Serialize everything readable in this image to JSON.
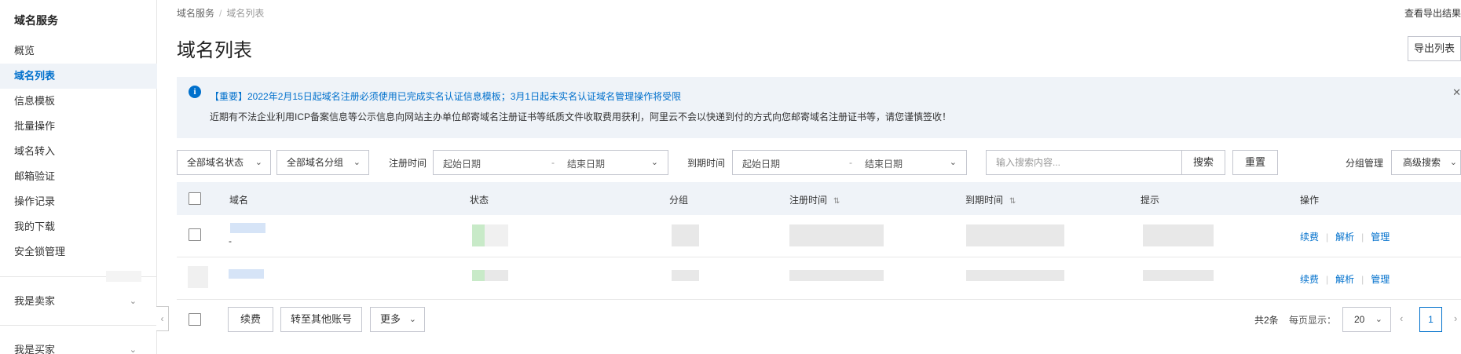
{
  "sidebar": {
    "title": "域名服务",
    "items": [
      {
        "label": "概览"
      },
      {
        "label": "域名列表"
      },
      {
        "label": "信息模板"
      },
      {
        "label": "批量操作"
      },
      {
        "label": "域名转入"
      },
      {
        "label": "邮箱验证"
      },
      {
        "label": "操作记录"
      },
      {
        "label": "我的下载"
      },
      {
        "label": "安全锁管理"
      }
    ],
    "active_index": 1,
    "groups": [
      {
        "label": "我是卖家"
      },
      {
        "label": "我是买家"
      }
    ]
  },
  "breadcrumb": {
    "root": "域名服务",
    "separator": "/",
    "current": "域名列表"
  },
  "page_title": "域名列表",
  "header": {
    "export_results_link": "查看导出结果",
    "export_list_button": "导出列表"
  },
  "notice": {
    "title": "【重要】2022年2月15日起域名注册必须使用已完成实名认证信息模板；3月1日起未实名认证域名管理操作将受限",
    "text": "近期有不法企业利用ICP备案信息等公示信息向网站主办单位邮寄域名注册证书等纸质文件收取费用获利，阿里云不会以快递到付的方式向您邮寄域名注册证书等，请您谨慎签收！",
    "info_icon_glyph": "i",
    "close_glyph": "✕"
  },
  "filters": {
    "status_select": "全部域名状态",
    "group_select": "全部域名分组",
    "reg_time_label": "注册时间",
    "exp_time_label": "到期时间",
    "start_date_placeholder": "起始日期",
    "end_date_placeholder": "结束日期",
    "date_separator": "-",
    "search_placeholder": "输入搜索内容...",
    "search_button": "搜索",
    "reset_button": "重置",
    "group_mgmt": "分组管理",
    "advanced_search": "高级搜索"
  },
  "table": {
    "columns": [
      "域名",
      "状态",
      "分组",
      "注册时间",
      "到期时间",
      "提示",
      "操作"
    ],
    "sort_glyph": "⇅",
    "rows": [
      {
        "domain_suffix": "-",
        "actions": [
          "续费",
          "解析",
          "管理"
        ]
      },
      {
        "actions": [
          "续费",
          "解析",
          "管理"
        ]
      }
    ]
  },
  "footer": {
    "renew_button": "续费",
    "transfer_button": "转至其他账号",
    "more_button": "更多",
    "total": "共2条",
    "per_page_label": "每页显示：",
    "per_page_value": "20",
    "current_page": "1",
    "prev_glyph": "‹",
    "next_glyph": "›"
  },
  "icons": {
    "chevron_down": "⌄",
    "collapse_sidebar": "‹"
  },
  "colors": {
    "accent": "#0070cc",
    "notice_bg": "#eff3f8",
    "table_header_bg": "#eff3f8",
    "status_green": "#c8eac8"
  }
}
